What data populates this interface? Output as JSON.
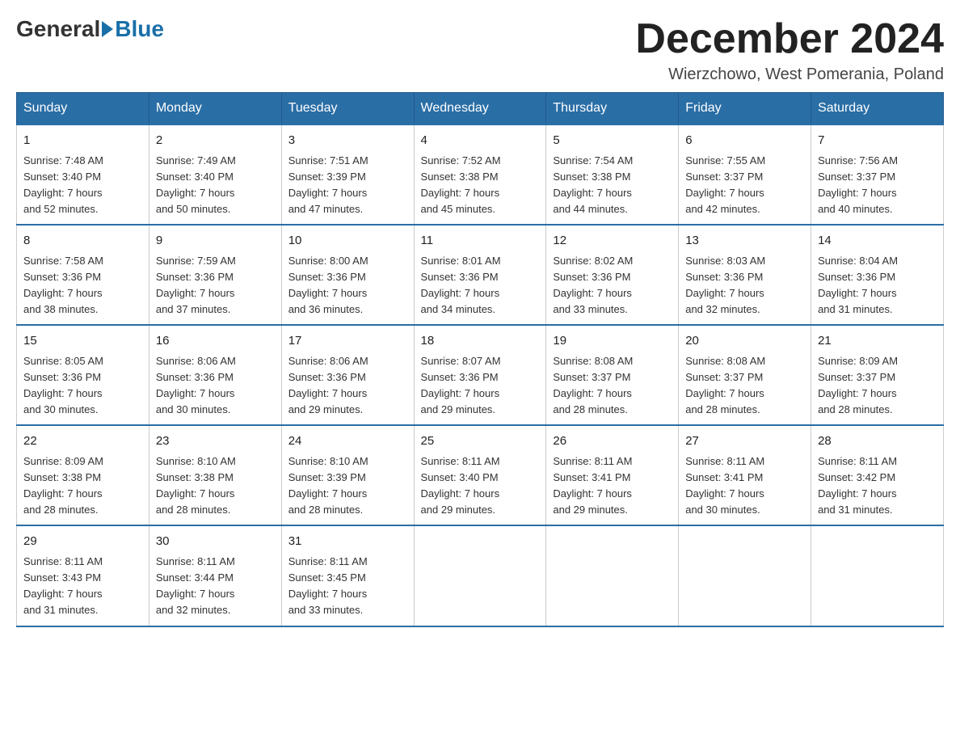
{
  "logo": {
    "general": "General",
    "blue": "Blue"
  },
  "header": {
    "month_title": "December 2024",
    "location": "Wierzchowo, West Pomerania, Poland"
  },
  "days_of_week": [
    "Sunday",
    "Monday",
    "Tuesday",
    "Wednesday",
    "Thursday",
    "Friday",
    "Saturday"
  ],
  "weeks": [
    [
      {
        "day": "1",
        "sunrise": "7:48 AM",
        "sunset": "3:40 PM",
        "daylight": "7 hours and 52 minutes."
      },
      {
        "day": "2",
        "sunrise": "7:49 AM",
        "sunset": "3:40 PM",
        "daylight": "7 hours and 50 minutes."
      },
      {
        "day": "3",
        "sunrise": "7:51 AM",
        "sunset": "3:39 PM",
        "daylight": "7 hours and 47 minutes."
      },
      {
        "day": "4",
        "sunrise": "7:52 AM",
        "sunset": "3:38 PM",
        "daylight": "7 hours and 45 minutes."
      },
      {
        "day": "5",
        "sunrise": "7:54 AM",
        "sunset": "3:38 PM",
        "daylight": "7 hours and 44 minutes."
      },
      {
        "day": "6",
        "sunrise": "7:55 AM",
        "sunset": "3:37 PM",
        "daylight": "7 hours and 42 minutes."
      },
      {
        "day": "7",
        "sunrise": "7:56 AM",
        "sunset": "3:37 PM",
        "daylight": "7 hours and 40 minutes."
      }
    ],
    [
      {
        "day": "8",
        "sunrise": "7:58 AM",
        "sunset": "3:36 PM",
        "daylight": "7 hours and 38 minutes."
      },
      {
        "day": "9",
        "sunrise": "7:59 AM",
        "sunset": "3:36 PM",
        "daylight": "7 hours and 37 minutes."
      },
      {
        "day": "10",
        "sunrise": "8:00 AM",
        "sunset": "3:36 PM",
        "daylight": "7 hours and 36 minutes."
      },
      {
        "day": "11",
        "sunrise": "8:01 AM",
        "sunset": "3:36 PM",
        "daylight": "7 hours and 34 minutes."
      },
      {
        "day": "12",
        "sunrise": "8:02 AM",
        "sunset": "3:36 PM",
        "daylight": "7 hours and 33 minutes."
      },
      {
        "day": "13",
        "sunrise": "8:03 AM",
        "sunset": "3:36 PM",
        "daylight": "7 hours and 32 minutes."
      },
      {
        "day": "14",
        "sunrise": "8:04 AM",
        "sunset": "3:36 PM",
        "daylight": "7 hours and 31 minutes."
      }
    ],
    [
      {
        "day": "15",
        "sunrise": "8:05 AM",
        "sunset": "3:36 PM",
        "daylight": "7 hours and 30 minutes."
      },
      {
        "day": "16",
        "sunrise": "8:06 AM",
        "sunset": "3:36 PM",
        "daylight": "7 hours and 30 minutes."
      },
      {
        "day": "17",
        "sunrise": "8:06 AM",
        "sunset": "3:36 PM",
        "daylight": "7 hours and 29 minutes."
      },
      {
        "day": "18",
        "sunrise": "8:07 AM",
        "sunset": "3:36 PM",
        "daylight": "7 hours and 29 minutes."
      },
      {
        "day": "19",
        "sunrise": "8:08 AM",
        "sunset": "3:37 PM",
        "daylight": "7 hours and 28 minutes."
      },
      {
        "day": "20",
        "sunrise": "8:08 AM",
        "sunset": "3:37 PM",
        "daylight": "7 hours and 28 minutes."
      },
      {
        "day": "21",
        "sunrise": "8:09 AM",
        "sunset": "3:37 PM",
        "daylight": "7 hours and 28 minutes."
      }
    ],
    [
      {
        "day": "22",
        "sunrise": "8:09 AM",
        "sunset": "3:38 PM",
        "daylight": "7 hours and 28 minutes."
      },
      {
        "day": "23",
        "sunrise": "8:10 AM",
        "sunset": "3:38 PM",
        "daylight": "7 hours and 28 minutes."
      },
      {
        "day": "24",
        "sunrise": "8:10 AM",
        "sunset": "3:39 PM",
        "daylight": "7 hours and 28 minutes."
      },
      {
        "day": "25",
        "sunrise": "8:11 AM",
        "sunset": "3:40 PM",
        "daylight": "7 hours and 29 minutes."
      },
      {
        "day": "26",
        "sunrise": "8:11 AM",
        "sunset": "3:41 PM",
        "daylight": "7 hours and 29 minutes."
      },
      {
        "day": "27",
        "sunrise": "8:11 AM",
        "sunset": "3:41 PM",
        "daylight": "7 hours and 30 minutes."
      },
      {
        "day": "28",
        "sunrise": "8:11 AM",
        "sunset": "3:42 PM",
        "daylight": "7 hours and 31 minutes."
      }
    ],
    [
      {
        "day": "29",
        "sunrise": "8:11 AM",
        "sunset": "3:43 PM",
        "daylight": "7 hours and 31 minutes."
      },
      {
        "day": "30",
        "sunrise": "8:11 AM",
        "sunset": "3:44 PM",
        "daylight": "7 hours and 32 minutes."
      },
      {
        "day": "31",
        "sunrise": "8:11 AM",
        "sunset": "3:45 PM",
        "daylight": "7 hours and 33 minutes."
      },
      null,
      null,
      null,
      null
    ]
  ],
  "labels": {
    "sunrise": "Sunrise:",
    "sunset": "Sunset:",
    "daylight": "Daylight:"
  },
  "colors": {
    "header_bg": "#2a6ea6",
    "header_text": "#ffffff",
    "border": "#2a6ea6"
  }
}
